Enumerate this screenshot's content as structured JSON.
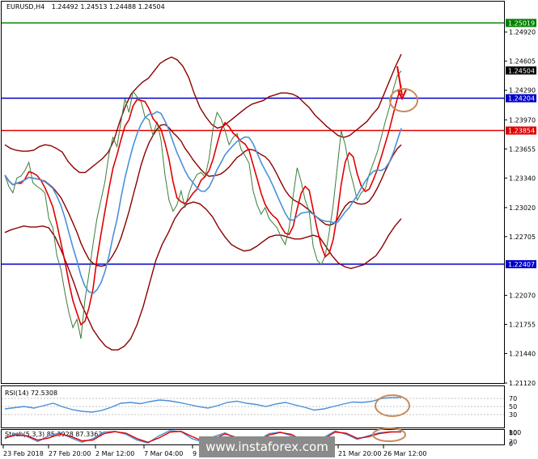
{
  "header": {
    "symbol": "EURUSD,H4",
    "ohlc": "1.24492 1.24513 1.24488 1.24504"
  },
  "rsi_label": "RSI(14) 72.5308",
  "stoch_label": "Stoch(5,3,3) 85.3928 87.3363",
  "watermark": "www.instaforex.com",
  "price_ticks": [
    "1.24920",
    "1.24605",
    "1.24290",
    "1.23970",
    "1.23655",
    "1.23340",
    "1.23020",
    "1.22705",
    "1.22070",
    "1.21755",
    "1.21440",
    "1.21120"
  ],
  "levels": [
    {
      "name": "top-level",
      "label": "1.25019",
      "value": 1.25019,
      "color": "#008000"
    },
    {
      "name": "current-price",
      "label": "1.24504",
      "value": 1.24504,
      "color": "#000000"
    },
    {
      "name": "resistance",
      "label": "1.24204",
      "value": 1.24204,
      "color": "#0000cc"
    },
    {
      "name": "pivot",
      "label": "1.23854",
      "value": 1.23854,
      "color": "#e00000"
    },
    {
      "name": "support",
      "label": "1.22407",
      "value": 1.22407,
      "color": "#0000cc"
    }
  ],
  "rsi_ticks": [
    "70",
    "50",
    "30"
  ],
  "stoch_ticks": [
    "100",
    "80",
    "20",
    "0"
  ],
  "time_labels": [
    "23 Feb 2018",
    "27 Feb 20:00",
    "2 Mar 12:00",
    "7 Mar 04:00",
    "9",
    "21 Mar 20:00",
    "26 Mar 12:00"
  ],
  "chart_data": [
    {
      "type": "line",
      "title": "EURUSD,H4",
      "ylim": [
        1.2112,
        1.2525
      ],
      "x": [
        0,
        2,
        4,
        6,
        8,
        10,
        12,
        14,
        16,
        18,
        20,
        22,
        24,
        26,
        28,
        30,
        32,
        34,
        36,
        38,
        40,
        42,
        44,
        46,
        48,
        50,
        52,
        54,
        56,
        58,
        60,
        62,
        64,
        66,
        68,
        70,
        72,
        74,
        76,
        78,
        80,
        82,
        84,
        86,
        88,
        90,
        92,
        94,
        96,
        98,
        100,
        102,
        104,
        106,
        108,
        110,
        112,
        114,
        116,
        118,
        120,
        122,
        124,
        126,
        128,
        130,
        132,
        134,
        136,
        138,
        140,
        142,
        144,
        146,
        148,
        150,
        152,
        154,
        156,
        158,
        160,
        162,
        164,
        166,
        168,
        170,
        172,
        174,
        176,
        178,
        180,
        182,
        184,
        186,
        188,
        190,
        192,
        194,
        196,
        198,
        200,
        202,
        204,
        206,
        208,
        210,
        212,
        214,
        216,
        218,
        220,
        222,
        224,
        226,
        228,
        230,
        232,
        234,
        236,
        238,
        240,
        242,
        244,
        246,
        248
      ],
      "series": [
        {
          "role": "close",
          "values": [
            1.2337,
            1.2325,
            1.2318,
            1.2334,
            1.2336,
            1.2342,
            1.2351,
            1.2329,
            1.2325,
            1.2322,
            1.2318,
            1.229,
            1.228,
            1.225,
            1.2235,
            1.221,
            1.2188,
            1.2172,
            1.2181,
            1.216,
            1.2202,
            1.223,
            1.2262,
            1.229,
            1.231,
            1.233,
            1.236,
            1.2378,
            1.2368,
            1.2395,
            1.242,
            1.2405,
            1.2428,
            1.2422,
            1.2417,
            1.24,
            1.2397,
            1.238,
            1.2395,
            1.2375,
            1.2337,
            1.231,
            1.2298,
            1.2305,
            1.232,
            1.2302,
            1.2318,
            1.233,
            1.2338,
            1.234,
            1.2335,
            1.2355,
            1.2388,
            1.2405,
            1.2398,
            1.2385,
            1.237,
            1.2378,
            1.2382,
            1.2365,
            1.2358,
            1.235,
            1.232,
            1.2305,
            1.2295,
            1.2302,
            1.229,
            1.2285,
            1.228,
            1.227,
            1.2262,
            1.228,
            1.2315,
            1.2345,
            1.233,
            1.231,
            1.2298,
            1.226,
            1.2245,
            1.224,
            1.225,
            1.2275,
            1.2305,
            1.2345,
            1.2385,
            1.237,
            1.2345,
            1.2328,
            1.231,
            1.2318,
            1.2322,
            1.2338,
            1.235,
            1.2362,
            1.2378,
            1.2395,
            1.241,
            1.243,
            1.2445,
            1.245
          ]
        },
        {
          "role": "bb-upper",
          "values": [
            1.237,
            1.2366,
            1.2364,
            1.2363,
            1.2363,
            1.2364,
            1.2368,
            1.237,
            1.2369,
            1.2366,
            1.2362,
            1.2352,
            1.2345,
            1.234,
            1.234,
            1.2345,
            1.235,
            1.2355,
            1.2362,
            1.2375,
            1.2395,
            1.2412,
            1.2425,
            1.2432,
            1.2438,
            1.2442,
            1.245,
            1.2458,
            1.2462,
            1.2465,
            1.2462,
            1.2455,
            1.2443,
            1.2425,
            1.241,
            1.24,
            1.2392,
            1.2388,
            1.239,
            1.2395,
            1.24,
            1.2405,
            1.241,
            1.2414,
            1.2416,
            1.2418,
            1.2422,
            1.2424,
            1.2426,
            1.2426,
            1.2425,
            1.2422,
            1.2416,
            1.241,
            1.2402,
            1.2396,
            1.239,
            1.2385,
            1.238,
            1.2378,
            1.238,
            1.2385,
            1.239,
            1.2395,
            1.2403,
            1.241,
            1.2425,
            1.244,
            1.2455,
            1.2468
          ]
        },
        {
          "role": "bb-lower",
          "values": [
            1.2275,
            1.2278,
            1.228,
            1.2282,
            1.2281,
            1.2281,
            1.2282,
            1.228,
            1.227,
            1.2255,
            1.2238,
            1.222,
            1.22,
            1.2185,
            1.217,
            1.216,
            1.2152,
            1.2148,
            1.2148,
            1.2152,
            1.216,
            1.2175,
            1.2195,
            1.222,
            1.2245,
            1.2262,
            1.2275,
            1.229,
            1.23,
            1.2306,
            1.2308,
            1.2306,
            1.23,
            1.2292,
            1.228,
            1.227,
            1.2262,
            1.2258,
            1.2255,
            1.2256,
            1.226,
            1.2265,
            1.227,
            1.2272,
            1.2272,
            1.227,
            1.2268,
            1.2268,
            1.227,
            1.2272,
            1.227,
            1.226,
            1.225,
            1.2242,
            1.2238,
            1.2236,
            1.2238,
            1.224,
            1.2245,
            1.225,
            1.226,
            1.2272,
            1.2282,
            1.229
          ]
        }
      ]
    },
    {
      "type": "line",
      "title": "RSI(14) 72.5308",
      "ylim": [
        0,
        100
      ],
      "series": [
        {
          "role": "rsi",
          "values": [
            44,
            47,
            50,
            46,
            52,
            58,
            49,
            42,
            38,
            36,
            40,
            48,
            58,
            60,
            57,
            62,
            66,
            64,
            60,
            55,
            50,
            46,
            52,
            60,
            63,
            58,
            55,
            50,
            56,
            60,
            54,
            48,
            41,
            44,
            50,
            56,
            61,
            60,
            63,
            70,
            72,
            72.5
          ]
        }
      ]
    },
    {
      "type": "line",
      "title": "Stoch(5,3,3) 85.3928 87.3363",
      "ylim": [
        0,
        100
      ],
      "series": [
        {
          "role": "main",
          "values": [
            40,
            75,
            55,
            20,
            60,
            80,
            45,
            15,
            40,
            85,
            90,
            70,
            30,
            10,
            60,
            95,
            88,
            40,
            15,
            55,
            80,
            40,
            10,
            30,
            75,
            85,
            60,
            20,
            10,
            50,
            92,
            70,
            35,
            60,
            80,
            88,
            85
          ]
        },
        {
          "role": "signal",
          "values": [
            45,
            65,
            60,
            30,
            45,
            72,
            55,
            25,
            30,
            75,
            88,
            78,
            40,
            15,
            45,
            85,
            90,
            55,
            22,
            40,
            72,
            50,
            18,
            25,
            65,
            82,
            70,
            30,
            12,
            40,
            85,
            78,
            42,
            52,
            75,
            85,
            87
          ]
        }
      ]
    }
  ]
}
